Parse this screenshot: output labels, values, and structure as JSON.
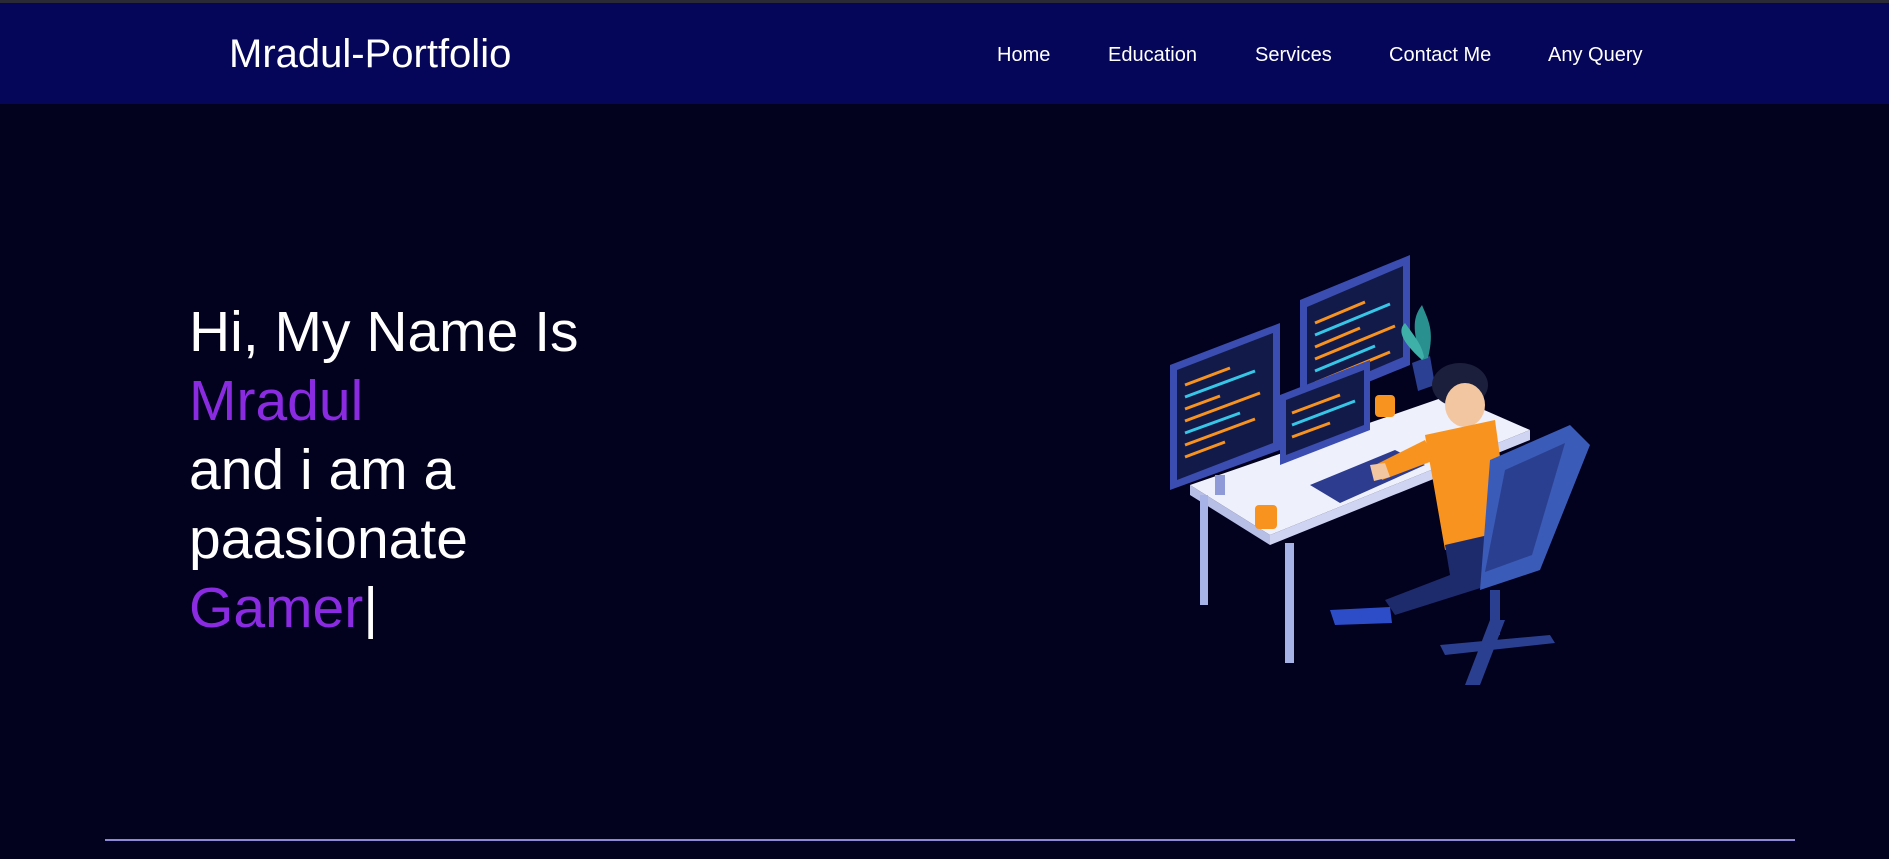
{
  "header": {
    "logo": "Mradul-Portfolio",
    "nav": [
      "Home",
      "Education",
      "Services",
      "Contact Me",
      "Any Query"
    ]
  },
  "hero": {
    "line1": "Hi, My Name Is",
    "name": "Mradul",
    "line3": "and i am a",
    "line4": "paasionate",
    "role": "Gamer",
    "cursor": "|"
  },
  "colors": {
    "background": "#02011e",
    "header": "#05055a",
    "accent": "#8a2be2",
    "divider": "#8f88d6"
  },
  "illustration": {
    "icon": "developer-at-desk-illustration"
  }
}
